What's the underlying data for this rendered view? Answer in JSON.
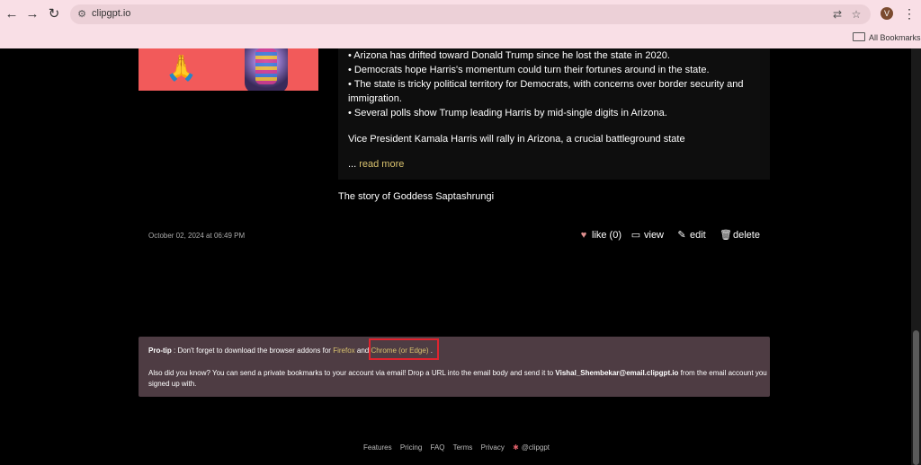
{
  "browser": {
    "url": "clipgpt.io",
    "avatar_letter": "V",
    "bookmarks_label": "All Bookmarks"
  },
  "post": {
    "bullets": [
      "• Arizona has drifted toward Donald Trump since he lost the state in 2020.",
      "• Democrats hope Harris's momentum could turn their fortunes around in the state.",
      "• The state is tricky political territory for Democrats, with concerns over border security and immigration.",
      "• Several polls show Trump leading Harris by mid-single digits in Arizona."
    ],
    "summary": "Vice President Kamala Harris will rally in Arizona, a crucial battleground state",
    "read_more_prefix": "...",
    "read_more": "read more",
    "title": "The story of Goddess Saptashrungi",
    "date": "October 02, 2024 at 06:49 PM",
    "actions": {
      "like": "like (0)",
      "view": "view",
      "edit": "edit",
      "delete": "delete"
    }
  },
  "protip": {
    "label": "Pro-tip",
    "text1": " : Don't forget to download the browser addons for ",
    "firefox": "Firefox",
    "and": " and ",
    "chrome": "Chrome (or Edge)",
    "end": " .",
    "text2": "Also did you know? You can send a private bookmarks to your account via email! Drop a URL into the email body and send it to ",
    "email": "Vishal_Shembekar@email.clipgpt.io",
    "text3": " from the email account you signed up with."
  },
  "footer": {
    "links": [
      "Features",
      "Pricing",
      "FAQ",
      "Terms",
      "Privacy"
    ],
    "handle": "@clipgpt"
  },
  "colors": {
    "accent_link": "#d9c26e",
    "highlight": "#e0242f",
    "chrome_bg": "#f9dfe6",
    "protip_bg": "#4e3c43"
  }
}
